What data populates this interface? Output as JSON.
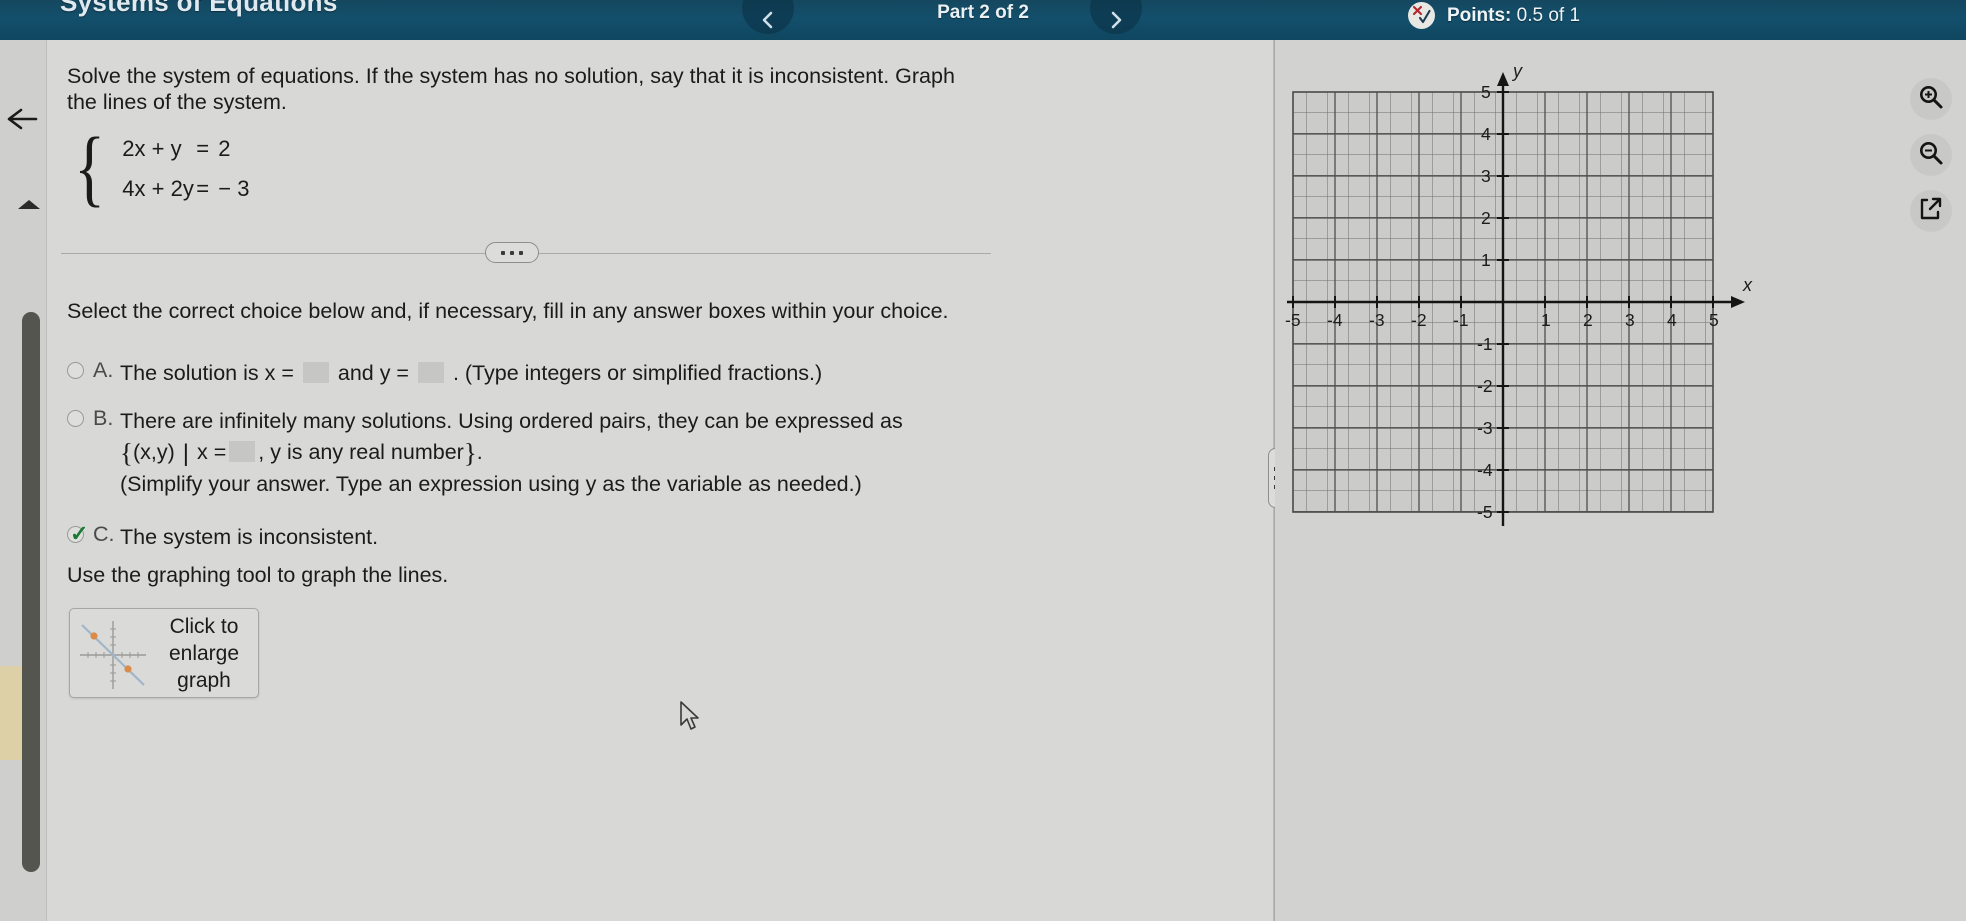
{
  "header": {
    "title": "Systems of Equations",
    "part_label": "Part 2 of 2",
    "points_label": "Points:",
    "points_value": "0.5 of 1",
    "prev_icon": "chevron-left-icon",
    "next_icon": "chevron-right-icon",
    "points_icon": "partial-credit-icon"
  },
  "question": {
    "prompt": "Solve the system of equations. If the system has no solution, say that it is inconsistent. Graph the lines of the system.",
    "equations": [
      {
        "lhs": "2x + y",
        "rel": "=",
        "rhs": "2"
      },
      {
        "lhs": "4x + 2y",
        "rel": "=",
        "rhs": "− 3"
      }
    ],
    "choice_intro": "Select the correct choice below and, if necessary, fill in any answer boxes within your choice.",
    "graph_instruction": "Use the graphing tool to graph the lines.",
    "choices": [
      {
        "letter": "A.",
        "text_before": "The solution is x =",
        "text_middle": "and y =",
        "text_after": ". (Type integers or simplified fractions.)",
        "selected": false,
        "answer_values": [
          "",
          ""
        ]
      },
      {
        "letter": "B.",
        "line1": "There are infinitely many solutions. Using ordered pairs, they can be expressed as",
        "set_prefix": "(x,y)",
        "set_condition_before": "x =",
        "set_condition_after": ", y is any real number",
        "line3": "(Simplify your answer. Type an expression using y as the variable as needed.)",
        "selected": false,
        "answer_values": [
          ""
        ]
      },
      {
        "letter": "C.",
        "text": "The system is inconsistent.",
        "selected": true
      }
    ]
  },
  "enlarge_button": {
    "label_line1": "Click to",
    "label_line2": "enlarge",
    "label_line3": "graph"
  },
  "left_rail": {
    "back_icon": "back-arrow-icon",
    "collapse_icon": "caret-up-icon"
  },
  "graph_tools": [
    {
      "name": "zoom-in-icon",
      "label": "Zoom in"
    },
    {
      "name": "zoom-out-icon",
      "label": "Zoom out"
    },
    {
      "name": "expand-icon",
      "label": "Expand graph"
    }
  ],
  "chart_data": {
    "type": "scatter",
    "title": "",
    "xlabel": "x",
    "ylabel": "y",
    "xlim": [
      -5,
      5
    ],
    "ylim": [
      -5,
      5
    ],
    "xticks": [
      -5,
      -4,
      -3,
      -2,
      -1,
      1,
      2,
      3,
      4,
      5
    ],
    "yticks": [
      5,
      4,
      3,
      2,
      1,
      -1,
      -2,
      -3,
      -4,
      -5
    ],
    "xtick_labels": [
      "-5",
      "-4",
      "-3",
      "-2",
      "-1",
      "1",
      "2",
      "3",
      "4",
      "5"
    ],
    "ytick_labels": [
      "5",
      "4",
      "3",
      "2",
      "1",
      "-1",
      "-2",
      "-3",
      "-4",
      "-5"
    ],
    "grid": true,
    "grid_step": 0.5,
    "legend": "none",
    "series": [],
    "annotations": [
      "empty coordinate grid, no lines plotted"
    ]
  },
  "colors": {
    "header_bg": "#134f6b",
    "page_bg": "#d2d2d0",
    "content_bg": "#d8d8d6",
    "text": "#1b1b1b",
    "checkmark_green": "#1d7a36",
    "answer_box": "#c6c6c4",
    "rail_highlight": "#ddd0a6"
  }
}
